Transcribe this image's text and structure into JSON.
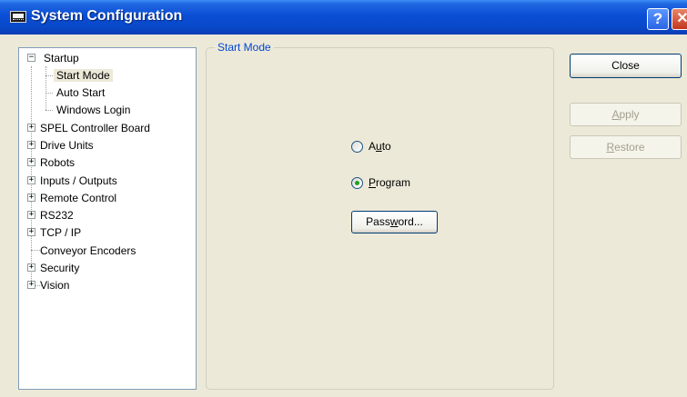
{
  "window": {
    "title": "System Configuration",
    "help_glyph": "?",
    "close_glyph": "✕"
  },
  "tree": {
    "startup": "Startup",
    "start_mode": "Start Mode",
    "auto_start": "Auto Start",
    "windows_login": "Windows Login",
    "spel": "SPEL Controller Board",
    "drive_units": "Drive Units",
    "robots": "Robots",
    "io": "Inputs / Outputs",
    "remote": "Remote Control",
    "rs232": "RS232",
    "tcpip": "TCP / IP",
    "conveyor": "Conveyor Encoders",
    "security": "Security",
    "vision": "Vision",
    "selected": "Start Mode"
  },
  "group": {
    "title": "Start Mode",
    "auto_pre": "A",
    "auto_u": "u",
    "auto_post": "to",
    "program_pre": "",
    "program_u": "P",
    "program_post": "rogram",
    "selected_option": "Program",
    "password_pre": "Pass",
    "password_u": "w",
    "password_post": "ord..."
  },
  "buttons": {
    "close": "Close",
    "apply_pre": "",
    "apply_u": "A",
    "apply_post": "pply",
    "restore_pre": "",
    "restore_u": "R",
    "restore_post": "estore"
  },
  "icons": {
    "app": "monitor-keyboard-icon",
    "expand": "plus-expander-icon",
    "collapse": "minus-expander-icon"
  },
  "colors": {
    "titlebar": "#0a4ed6",
    "group_title": "#0046d5",
    "window_bg": "#ece9d8",
    "radio_dot": "#21a121"
  }
}
